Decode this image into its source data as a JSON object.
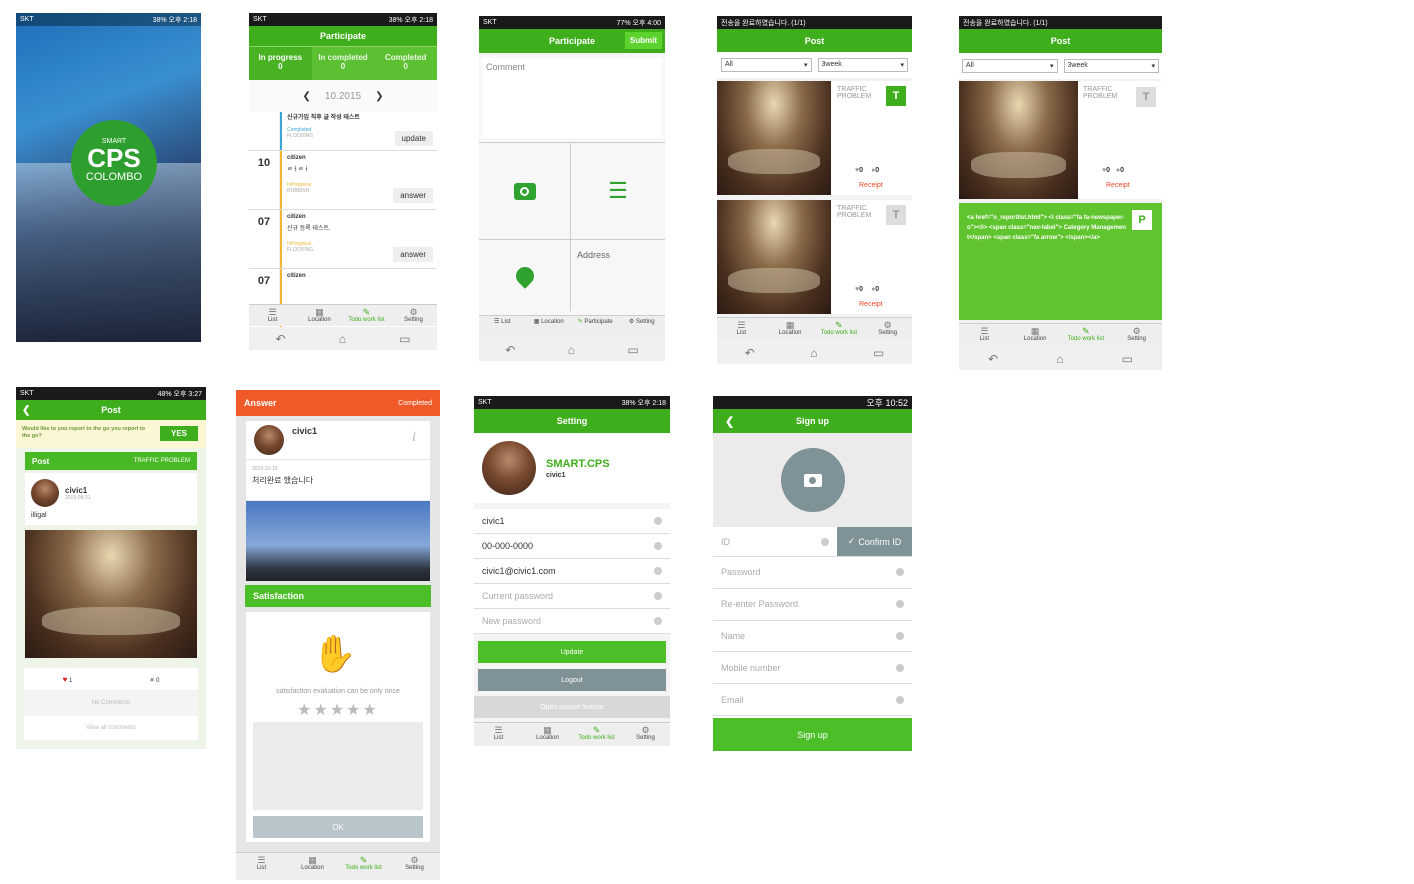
{
  "colors": {
    "green": "#3fae1c",
    "orange": "#f05a28",
    "grey": "#8a9ba3"
  },
  "status": {
    "s1": {
      "carrier": "SKT",
      "time": "오후 2:18",
      "battery": "38%"
    },
    "s3": {
      "carrier": "SKT",
      "time": "오후 4:00",
      "battery": "77%"
    },
    "s4": {
      "notice": "전송을 완료하였습니다. (1/1)"
    },
    "s6": {
      "carrier": "SKT",
      "time": "오후 3:27",
      "battery": "48%"
    },
    "s8": {
      "carrier": "SKT",
      "time": "오후 2:18",
      "battery": "38%"
    },
    "s9": {
      "time": "오후 10:52"
    }
  },
  "nav": {
    "list": "List",
    "location": "Location",
    "todo": "Todo work list",
    "setting": "Setting",
    "participate": "Participate"
  },
  "splash": {
    "smart": "SMART",
    "cps": "CPS",
    "colombo": "COLOMBO"
  },
  "participate_list": {
    "title": "Participate",
    "tabs": [
      {
        "label": "In progress",
        "count": "0"
      },
      {
        "label": "In completed",
        "count": "0"
      },
      {
        "label": "Completed",
        "count": "0"
      }
    ],
    "month": "10.2015",
    "rows": [
      {
        "num": "",
        "user": "신규가입 직후 글 작성 테스트",
        "desc": "",
        "status": "Completed",
        "category": "FLOODING",
        "action": "update"
      },
      {
        "num": "10",
        "user": "citizen",
        "desc": "ㄹㅓㄹㅓ",
        "status": "InProgress",
        "category": "RUBBISH",
        "action": "answer"
      },
      {
        "num": "07",
        "user": "citizen",
        "desc": "신규 등록 테스트.",
        "status": "InProgress",
        "category": "FLOODING",
        "action": "answer"
      },
      {
        "num": "07",
        "user": "citizen",
        "desc": "",
        "status": "",
        "category": "",
        "action": ""
      }
    ]
  },
  "participate_form": {
    "title": "Participate",
    "submit": "Submit",
    "comment_placeholder": "Comment",
    "address": "Address"
  },
  "post_list": {
    "title": "Post",
    "filter_all": "All",
    "filter_period": "3week",
    "cards": [
      {
        "category": "TRAFFIC PROBLEM",
        "type": "T",
        "likes": "0",
        "comments": "0",
        "action": "Receipt"
      },
      {
        "category": "TRAFFIC PROBLEM",
        "type": "T",
        "likes": "0",
        "comments": "0",
        "action": "Receipt"
      }
    ]
  },
  "post_p": {
    "title": "Post",
    "filter_all": "All",
    "filter_period": "3week",
    "card": {
      "category": "TRAFFIC PROBLEM",
      "type": "T",
      "likes": "0",
      "comments": "0",
      "action": "Receipt"
    },
    "code_type": "P",
    "code_text": "<a href=\"o_reportlist.html\"> <i class=\"fa fa-newspaper-o\"></i> <span class=\"nav-label\"> Category Management</span> <span class=\"fa arrow\"> </span></a>"
  },
  "post_detail": {
    "title": "Post",
    "question": "Would like to you report to the go you report to the go?",
    "yes": "YES",
    "bar_label": "Post",
    "bar_category": "TRAFFIC PROBLEM",
    "user": "civic1",
    "date": "2015-08-21",
    "text": "illigal",
    "likes": "1",
    "comments": "0",
    "no_comments": "No Comments",
    "view_all": "View all comments"
  },
  "answer": {
    "title": "Answer",
    "status": "Completed",
    "user": "civic1",
    "date": "2015-10-16",
    "text": "처리완료 했습니다",
    "satisfaction": "Satisfaction",
    "note": "satisfaction evaluation can be only once",
    "ok": "OK"
  },
  "setting": {
    "title": "Setting",
    "brand": "SMART.CPS",
    "user": "civic1",
    "fields": [
      {
        "value": "civic1",
        "placeholder": ""
      },
      {
        "value": "00-000-0000",
        "placeholder": ""
      },
      {
        "value": "civic1@civic1.com",
        "placeholder": ""
      },
      {
        "value": "",
        "placeholder": "Current password"
      },
      {
        "value": "",
        "placeholder": "New password"
      }
    ],
    "update": "Update",
    "logout": "Logout",
    "license": "Open source license"
  },
  "signup": {
    "title": "Sign up",
    "id_placeholder": "ID",
    "confirm": "Confirm ID",
    "fields": [
      "Password",
      "Re-enter Password",
      "Name",
      "Mobile number",
      "Email"
    ],
    "submit": "Sign up"
  }
}
